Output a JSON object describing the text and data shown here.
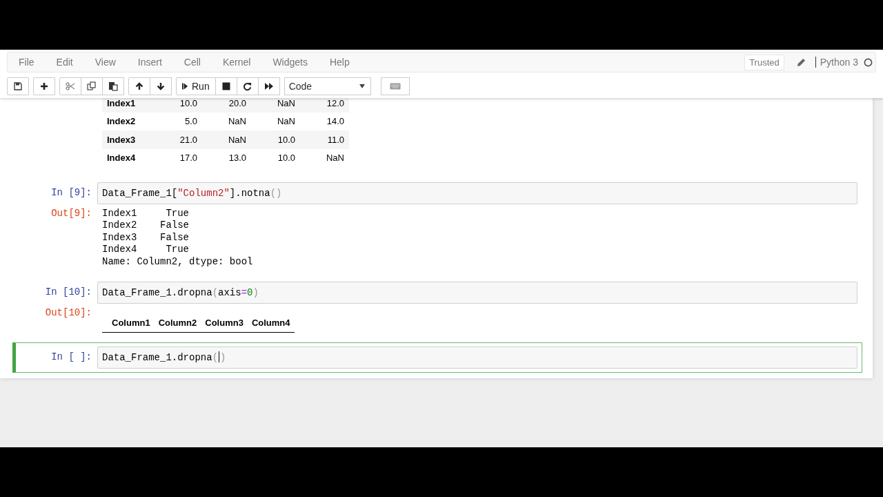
{
  "menu": [
    {
      "label": "File"
    },
    {
      "label": "Edit"
    },
    {
      "label": "View"
    },
    {
      "label": "Insert"
    },
    {
      "label": "Cell"
    },
    {
      "label": "Kernel"
    },
    {
      "label": "Widgets"
    },
    {
      "label": "Help"
    }
  ],
  "header_right": {
    "trusted": "Trusted",
    "kernel": "Python 3"
  },
  "toolbar": [
    {
      "buttons": [
        {
          "kind": "save"
        }
      ]
    },
    {
      "buttons": [
        {
          "kind": "add"
        }
      ]
    },
    {
      "buttons": [
        {
          "kind": "cut"
        },
        {
          "kind": "copy"
        },
        {
          "kind": "paste"
        }
      ]
    },
    {
      "buttons": [
        {
          "kind": "up"
        },
        {
          "kind": "down"
        }
      ]
    },
    {
      "buttons": [
        {
          "kind": "run",
          "label": "Run"
        },
        {
          "kind": "stop"
        },
        {
          "kind": "restart"
        },
        {
          "kind": "fast-forward"
        }
      ]
    }
  ],
  "cell_type": "Code",
  "cells": [
    {
      "output": {
        "kind": "table",
        "rows": [
          {
            "index": "Index1",
            "values": [
              "10.0",
              "20.0",
              "NaN",
              "12.0"
            ]
          },
          {
            "index": "Index2",
            "values": [
              "5.0",
              "NaN",
              "NaN",
              "14.0"
            ]
          },
          {
            "index": "Index3",
            "values": [
              "21.0",
              "NaN",
              "10.0",
              "11.0"
            ]
          },
          {
            "index": "Index4",
            "values": [
              "17.0",
              "13.0",
              "10.0",
              "NaN"
            ]
          }
        ]
      }
    },
    {
      "prompt": "In [9]:",
      "selected": false,
      "code": [
        {
          "text": "Data_Frame_1[",
          "kind": "plain"
        },
        {
          "text": "\"Column2\"",
          "kind": "string"
        },
        {
          "text": "].notna",
          "kind": "plain"
        },
        {
          "text": "()",
          "kind": "paren"
        }
      ],
      "output": {
        "kind": "text",
        "prompt": "Out[9]:",
        "lines": [
          "Index1     True",
          "Index2    False",
          "Index3    False",
          "Index4     True",
          "Name: Column2, dtype: bool"
        ]
      }
    },
    {
      "prompt": "In [10]:",
      "selected": false,
      "code": [
        {
          "text": "Data_Frame_1.dropna",
          "kind": "plain"
        },
        {
          "text": "(",
          "kind": "paren"
        },
        {
          "text": "axis",
          "kind": "plain"
        },
        {
          "text": "=",
          "kind": "operator"
        },
        {
          "text": "0",
          "kind": "number"
        },
        {
          "text": ")",
          "kind": "paren"
        }
      ],
      "output": {
        "kind": "table",
        "prompt": "Out[10]:",
        "columns": [
          "Column1",
          "Column2",
          "Column3",
          "Column4"
        ]
      }
    },
    {
      "prompt": "In [ ]:",
      "selected": true,
      "code": [
        {
          "text": "Data_Frame_1.dropna",
          "kind": "plain"
        },
        {
          "text": "(",
          "kind": "paren",
          "cursor": true
        },
        {
          "text": ")",
          "kind": "paren"
        }
      ]
    }
  ]
}
